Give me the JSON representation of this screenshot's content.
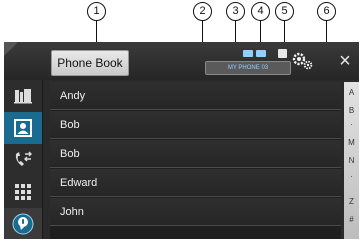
{
  "callouts": [
    "1",
    "2",
    "3",
    "4",
    "5",
    "6"
  ],
  "header": {
    "title": "Phone Book",
    "device_name": "MY PHONE 03",
    "close_glyph": "×"
  },
  "sidebar": {
    "items": [
      {
        "icon": "call-history-icon"
      },
      {
        "icon": "phone-book-icon",
        "active": true
      },
      {
        "icon": "preset-dial-icon"
      },
      {
        "icon": "keypad-icon"
      },
      {
        "icon": "voice-recognition-icon"
      }
    ]
  },
  "contacts": [
    "Andy",
    "Bob",
    "Bob",
    "Edward",
    "John"
  ],
  "index_bar": [
    "A",
    "B",
    "·",
    "M",
    "N",
    "·",
    "Z",
    "#"
  ],
  "colors": {
    "accent": "#1a6b8f",
    "device_text": "#8fd0ff"
  }
}
